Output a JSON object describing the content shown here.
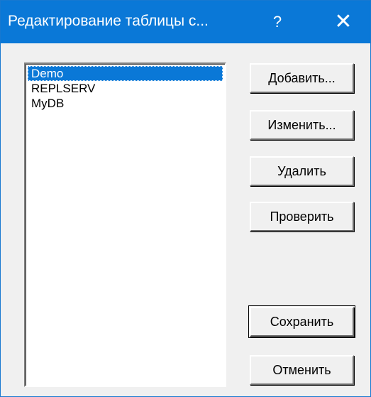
{
  "window": {
    "title": "Редактирование таблицы с...",
    "help_glyph": "?",
    "close_glyph": "✕"
  },
  "list": {
    "items": [
      "Demo",
      "REPLSERV",
      "MyDB"
    ],
    "selected": "Demo"
  },
  "buttons": {
    "add": "Добавить...",
    "edit": "Изменить...",
    "delete": "Удалить",
    "check": "Проверить",
    "save": "Сохранить",
    "cancel": "Отменить"
  },
  "colors": {
    "titlebar": "#0a78d7",
    "selection": "#0a78d7",
    "dialog_bg": "#f0f0f0"
  }
}
